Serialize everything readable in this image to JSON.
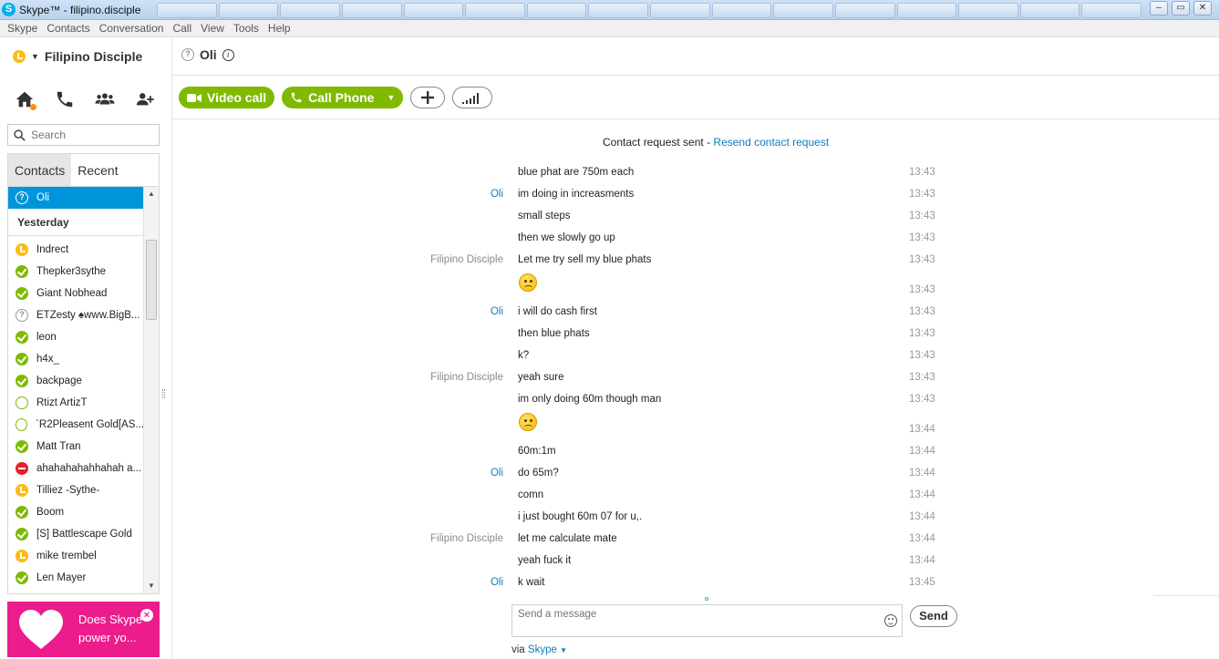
{
  "window": {
    "title": "Skype™ - filipino.disciple",
    "controls": [
      "–",
      "▭",
      "✕"
    ]
  },
  "menu": [
    "Skype",
    "Contacts",
    "Conversation",
    "Call",
    "View",
    "Tools",
    "Help"
  ],
  "profile": {
    "name": "Filipino Disciple",
    "status": "away"
  },
  "search": {
    "placeholder": "Search"
  },
  "tabs": [
    "Contacts",
    "Recent"
  ],
  "contacts": {
    "selected": {
      "name": "Oli",
      "status": "unknown"
    },
    "group": "Yesterday",
    "items": [
      {
        "name": "Indrect",
        "status": "away"
      },
      {
        "name": "Thepker3sythe",
        "status": "online"
      },
      {
        "name": "Giant Nobhead",
        "status": "online"
      },
      {
        "name": "ETZesty ♠www.BigB...",
        "status": "unknown"
      },
      {
        "name": "leon",
        "status": "online"
      },
      {
        "name": "h4x_",
        "status": "online"
      },
      {
        "name": "backpage",
        "status": "online"
      },
      {
        "name": "Rtizt ArtizT",
        "status": "offline"
      },
      {
        "name": "`R2Pleasent Gold[AS...",
        "status": "offline"
      },
      {
        "name": "Matt Tran",
        "status": "online"
      },
      {
        "name": "ahahahahahhahah a...",
        "status": "dnd"
      },
      {
        "name": "Tilliez -Sythe-",
        "status": "away"
      },
      {
        "name": "Boom",
        "status": "online"
      },
      {
        "name": "[S] Battlescape Gold",
        "status": "online"
      },
      {
        "name": "mike trembel",
        "status": "away"
      },
      {
        "name": "Len Mayer",
        "status": "online"
      }
    ]
  },
  "ad": {
    "text_line1": "Does Skype",
    "text_line2": "power yo...",
    "close": "×"
  },
  "chat": {
    "contact": "Oli",
    "video_call": "Video call",
    "call_phone": "Call Phone",
    "request_text": "Contact request sent - ",
    "request_link": "Resend contact request",
    "compose_placeholder": "Send a message",
    "send": "Send",
    "via": "via ",
    "via_link": "Skype"
  },
  "messages": [
    {
      "sender": "",
      "text": "blue phat are 750m each",
      "time": "13:43"
    },
    {
      "sender": "Oli",
      "text": "im doing in increasments",
      "time": "13:43"
    },
    {
      "sender": "",
      "text": "small steps",
      "time": "13:43"
    },
    {
      "sender": "",
      "text": "then we slowly go up",
      "time": "13:43"
    },
    {
      "sender": "Filipino Disciple",
      "text": "Let me try sell my blue phats",
      "time": "13:43"
    },
    {
      "sender": "",
      "text": "",
      "emoji": "worried",
      "time": "13:43"
    },
    {
      "sender": "Oli",
      "text": "i will do cash first",
      "time": "13:43"
    },
    {
      "sender": "",
      "text": "then blue phats",
      "time": "13:43"
    },
    {
      "sender": "",
      "text": "k?",
      "time": "13:43"
    },
    {
      "sender": "Filipino Disciple",
      "text": "yeah sure",
      "time": "13:43"
    },
    {
      "sender": "",
      "text": "im only doing 60m though man",
      "time": "13:43"
    },
    {
      "sender": "",
      "text": "",
      "emoji": "worried",
      "time": "13:44"
    },
    {
      "sender": "",
      "text": "60m:1m",
      "time": "13:44"
    },
    {
      "sender": "Oli",
      "text": "do 65m?",
      "time": "13:44"
    },
    {
      "sender": "",
      "text": "comn",
      "time": "13:44"
    },
    {
      "sender": "",
      "text": "i just bought 60m 07 for u,.",
      "time": "13:44"
    },
    {
      "sender": "Filipino Disciple",
      "text": "let me calculate mate",
      "time": "13:44"
    },
    {
      "sender": "",
      "text": "yeah fuck it",
      "time": "13:44"
    },
    {
      "sender": "Oli",
      "text": "k wait",
      "time": "13:45"
    }
  ],
  "colors": {
    "accent": "#00aff0",
    "green": "#7fba00",
    "selected": "#0095db",
    "link": "#0f7dc2",
    "ad": "#ec1c8c"
  }
}
